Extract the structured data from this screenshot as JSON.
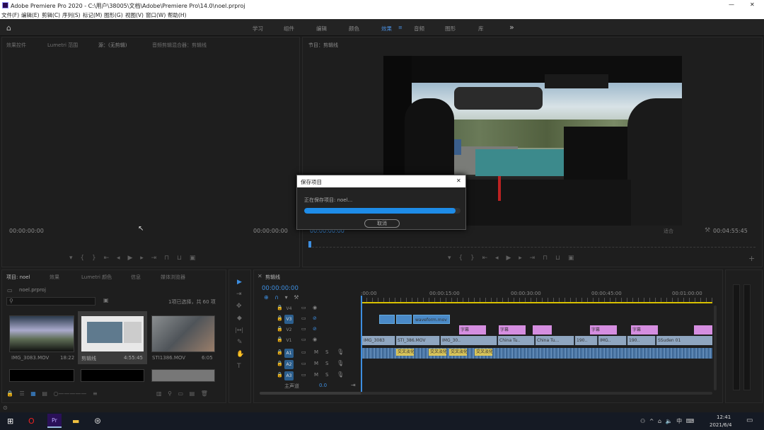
{
  "window": {
    "title": "Adobe Premiere Pro 2020 - C:\\用户\\38005\\文档\\Adobe\\Premiere Pro\\14.0\\noel.prproj",
    "minimize": "—",
    "close": "✕"
  },
  "menu": [
    "文件(F)",
    "编辑(E)",
    "剪辑(C)",
    "序列(S)",
    "标记(M)",
    "图形(G)",
    "视图(V)",
    "窗口(W)",
    "帮助(H)"
  ],
  "workspaces": [
    "学习",
    "组件",
    "编辑",
    "颜色",
    "效果",
    "音频",
    "图形",
    "库"
  ],
  "workspace_more": "»",
  "source": {
    "tabs": [
      "效果控件",
      "Lumetri 范围",
      "源：(无剪辑)",
      "音频剪辑混合器：剪辑线"
    ],
    "tc_left": "00:00:00:00",
    "tc_right": "00:00:00:00"
  },
  "program": {
    "tab": "节目：剪辑线",
    "tc_left": "00:00:00:00",
    "tc_right": "00:04:55:45",
    "fit": "适合"
  },
  "dialog": {
    "title": "保存项目",
    "close": "✕",
    "message": "正在保存项目: noel...",
    "progress": 0.97,
    "cancel": "取消"
  },
  "project": {
    "tabs": [
      "项目: noel",
      "效果",
      "Lumetri 颜色",
      "信息",
      "媒体浏览器"
    ],
    "file": "noel.prproj",
    "count": "1项已选择，共 60 项",
    "items": [
      {
        "name": "IMG_3083.MOV",
        "dur": "18:22"
      },
      {
        "name": "剪辑线",
        "dur": "4:55:45"
      },
      {
        "name": "STI1386.MOV",
        "dur": "6:05"
      }
    ]
  },
  "tools": [
    "▶",
    "⇥",
    "✥",
    "◆",
    "|↔|",
    "✎",
    "✋",
    "T"
  ],
  "timeline": {
    "tab": "剪辑线",
    "tc": "00:00:00:00",
    "ruler": [
      ":00:00",
      "00:00:15:00",
      "00:00:30:00",
      "00:00:45:00",
      "00:01:00:00"
    ],
    "video_tracks": [
      "V4",
      "V3",
      "V2",
      "V1"
    ],
    "audio_tracks": [
      "A1",
      "A2",
      "A3"
    ],
    "master": "主声道",
    "master_val": "0.0",
    "clips_v3": [
      "",
      "",
      "waveform.mov"
    ],
    "clips_v2": [
      "字幕",
      "字幕",
      "",
      "字幕",
      "字幕",
      ""
    ],
    "clips_v1": [
      "IMG_3083",
      "STI_386.MOV",
      "IMG_30..",
      "China Tu..",
      "China Tu...",
      "190..",
      "IMG..",
      "190..",
      "SSuden 01"
    ],
    "clips_a1": [
      "交叉淡化",
      "交叉淡化",
      "交叉淡化",
      "交叉淡化"
    ]
  },
  "taskbar": {
    "time": "12:41",
    "date": "2021/6/4",
    "ime": "中"
  }
}
